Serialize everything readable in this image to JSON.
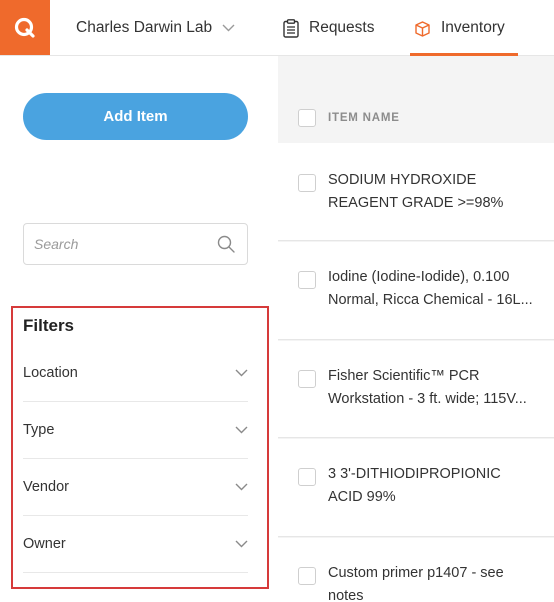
{
  "app": {
    "brand_color": "#ef6a2c",
    "accent_color": "#4aa3e0",
    "highlight_color": "#d63a3a"
  },
  "topbar": {
    "lab_name": "Charles Darwin Lab",
    "tabs": [
      {
        "label": "Requests",
        "icon": "clipboard-icon",
        "active": false
      },
      {
        "label": "Inventory",
        "icon": "box-icon",
        "active": true
      }
    ]
  },
  "sidebar": {
    "add_item_label": "Add Item",
    "search_placeholder": "Search",
    "filters_title": "Filters",
    "filters": [
      {
        "label": "Location"
      },
      {
        "label": "Type"
      },
      {
        "label": "Vendor"
      },
      {
        "label": "Owner"
      }
    ]
  },
  "table": {
    "column_header": "ITEM NAME",
    "items": [
      {
        "line1": "SODIUM HYDROXIDE",
        "line2": "REAGENT GRADE >=98%"
      },
      {
        "line1": "Iodine (Iodine-Iodide), 0.100",
        "line2": "Normal, Ricca Chemical - 16L..."
      },
      {
        "line1": "Fisher Scientific™ PCR",
        "line2": "Workstation - 3 ft. wide; 115V..."
      },
      {
        "line1": "3 3'-DITHIODIPROPIONIC",
        "line2": "ACID 99%"
      },
      {
        "line1": "Custom primer p1407 - see",
        "line2": "notes"
      }
    ]
  }
}
